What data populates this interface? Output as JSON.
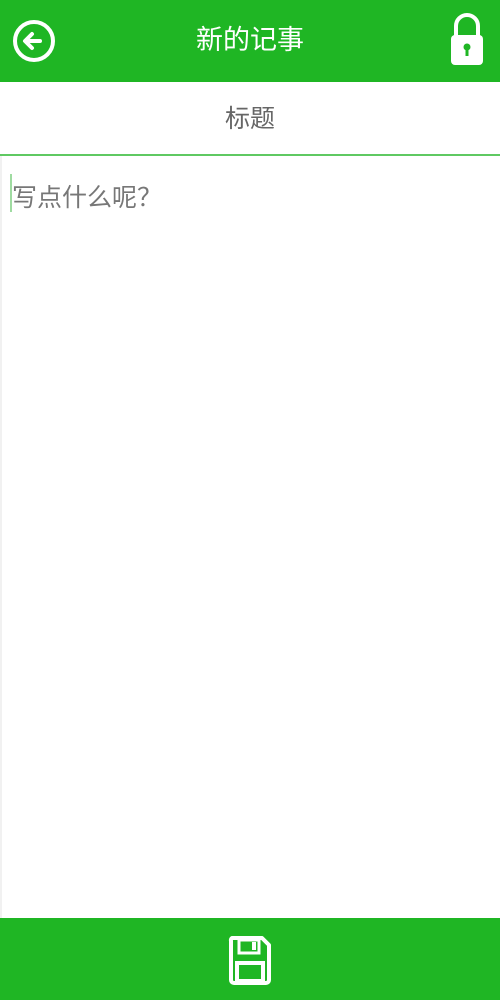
{
  "header": {
    "title": "新的记事",
    "back_icon": "back-arrow-circle-icon",
    "lock_icon": "lock-icon"
  },
  "note": {
    "title_placeholder": "标题",
    "title_value": "",
    "body_placeholder": "写点什么呢？",
    "body_value": ""
  },
  "footer": {
    "save_icon": "floppy-disk-save-icon"
  },
  "colors": {
    "accent": "#1fb624",
    "divider": "#5fc962",
    "text": "#555555"
  }
}
